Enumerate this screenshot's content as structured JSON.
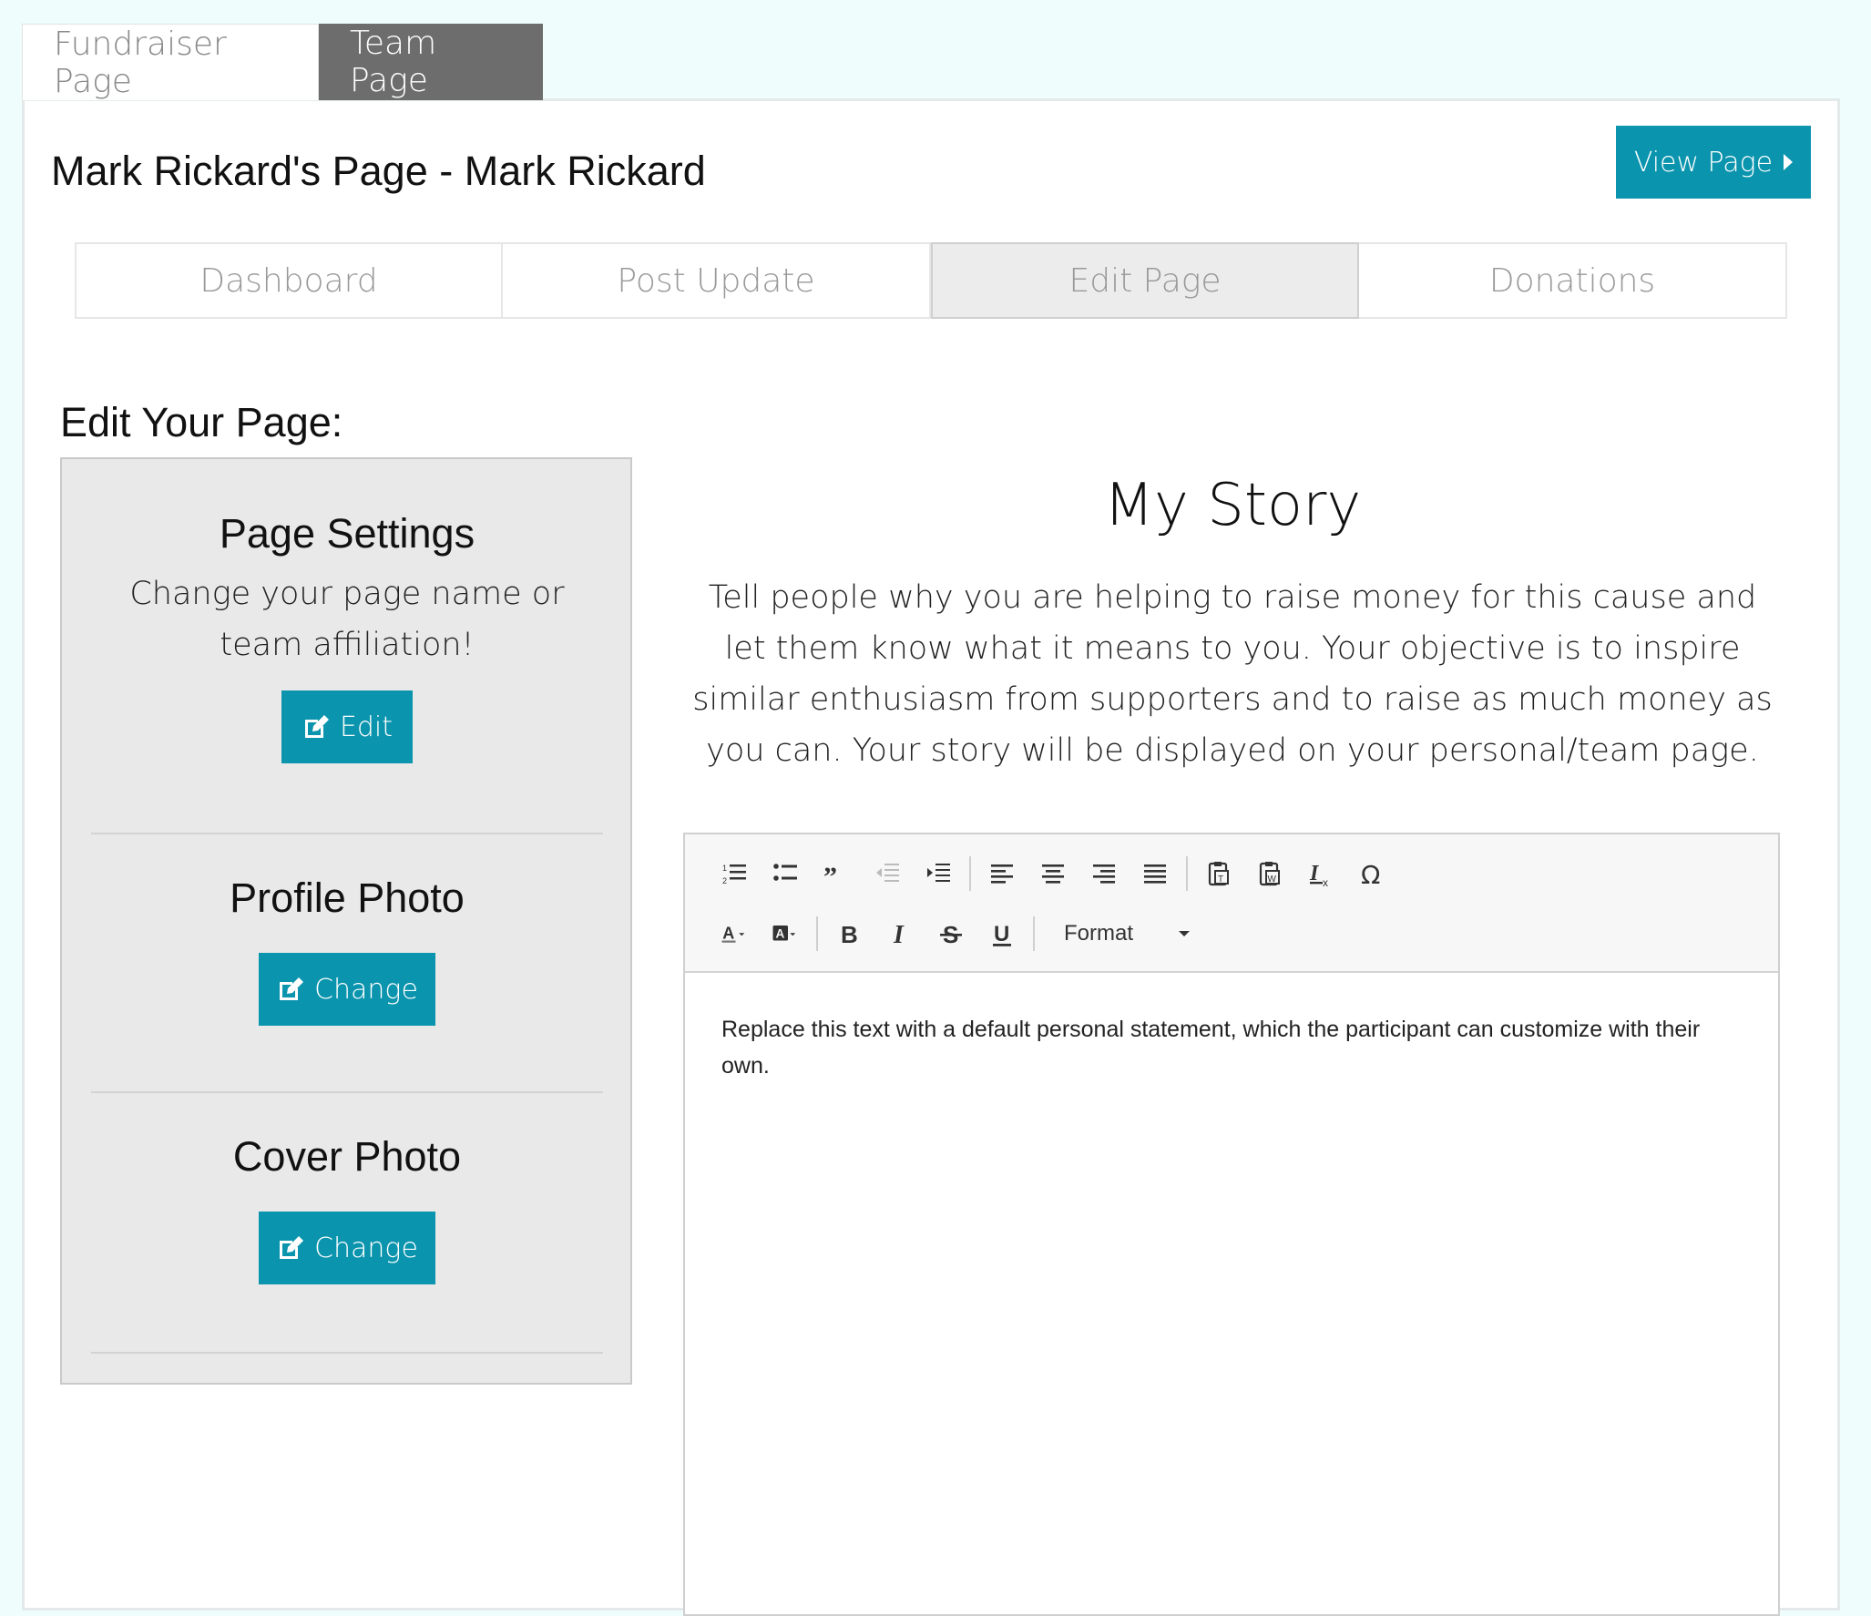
{
  "top_tabs": {
    "fundraiser": "Fundraiser Page",
    "team": "Team Page"
  },
  "header": {
    "title": "Mark Rickard's Page - Mark Rickard",
    "view_page": "View Page"
  },
  "nav": {
    "dashboard": "Dashboard",
    "post_update": "Post Update",
    "edit_page": "Edit Page",
    "donations": "Donations"
  },
  "sidebar": {
    "heading": "Edit Your Page:",
    "page_settings": {
      "title": "Page Settings",
      "desc": "Change your page name or team affiliation!",
      "button": "Edit"
    },
    "profile_photo": {
      "title": "Profile Photo",
      "button": "Change"
    },
    "cover_photo": {
      "title": "Cover Photo",
      "button": "Change"
    }
  },
  "story": {
    "title": "My Story",
    "desc": "Tell people why you are helping to raise money for this cause and let them know what it means to you. Your objective is to inspire similar enthusiasm from supporters and to raise as much money as you can. Your story will be displayed on your personal/team page."
  },
  "editor": {
    "format_label": "Format",
    "content": "Replace this text with a default personal statement, which the participant can customize with their own."
  },
  "colors": {
    "accent": "#0a94ad",
    "active_tab": "#6d6d6d",
    "page_bg": "#effdfd"
  }
}
